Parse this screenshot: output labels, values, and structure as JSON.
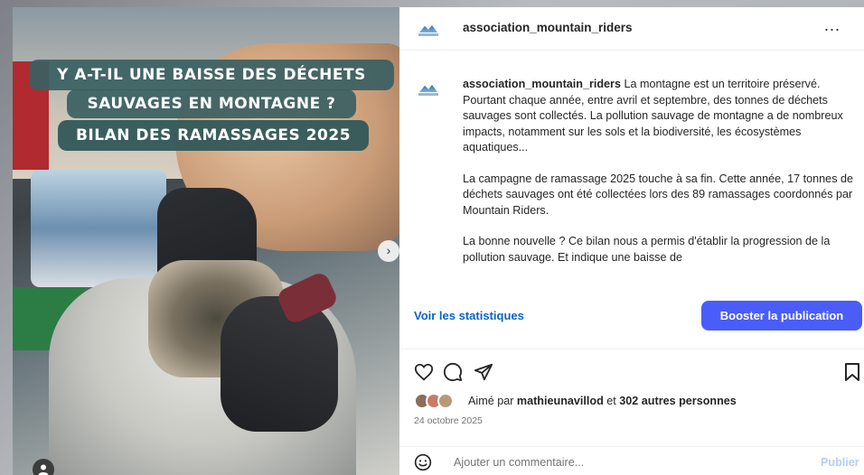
{
  "post": {
    "title_lines": [
      "Y A-T-IL UNE BAISSE DES DÉCHETS",
      "SAUVAGES EN MONTAGNE ?",
      "BILAN DES RAMASSAGES 2025"
    ],
    "next_glyph": "›"
  },
  "header": {
    "username": "association_mountain_riders",
    "more_label": "..."
  },
  "caption": {
    "username": "association_mountain_riders",
    "paragraph1": " La montagne est un territoire préservé. Pourtant chaque année, entre avril et septembre, des tonnes de déchets sauvages sont collectés. La pollution sauvage de montagne a de nombreux impacts, notamment sur les sols et la biodiversité, les écosystèmes aquatiques...",
    "paragraph2": "La campagne de ramassage 2025 touche à sa fin. Cette année, 17 tonnes de déchets sauvages ont été collectées lors des 89 ramassages coordonnés par Mountain Riders.",
    "paragraph3": "La bonne nouvelle ? Ce bilan nous a permis d'établir la progression de la pollution sauvage. Et indique une baisse de"
  },
  "actions": {
    "stats_label": "Voir les statistiques",
    "boost_label": "Booster la publication"
  },
  "likes": {
    "prefix": "Aimé par ",
    "first_user": "mathieunavillod",
    "middle": " et ",
    "others": "302 autres personnes",
    "avatar_colors": [
      "#8a6d5a",
      "#c97b6a",
      "#b59a7a"
    ]
  },
  "date": "24 octobre 2025",
  "comment": {
    "placeholder": "Ajouter un commentaire...",
    "publish_label": "Publier"
  },
  "colors": {
    "accent": "#4a5df9",
    "link": "#0a64c4"
  }
}
